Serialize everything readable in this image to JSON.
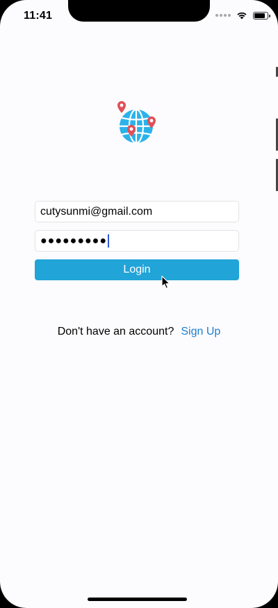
{
  "status_bar": {
    "time": "11:41",
    "battery_level": 0.9
  },
  "logo": {
    "icon": "globe-with-location-pins-icon",
    "colors": {
      "globe": "#2ab3ea",
      "pin": "#e0505a"
    }
  },
  "login_form": {
    "email_value": "cutysunmi@gmail.com",
    "password_masked": "●●●●●●●●●",
    "login_label": "Login"
  },
  "signup": {
    "prompt": "Don't have an account?",
    "link_label": "Sign Up"
  },
  "colors": {
    "accent": "#21a4d8",
    "link": "#1d7fd0"
  }
}
